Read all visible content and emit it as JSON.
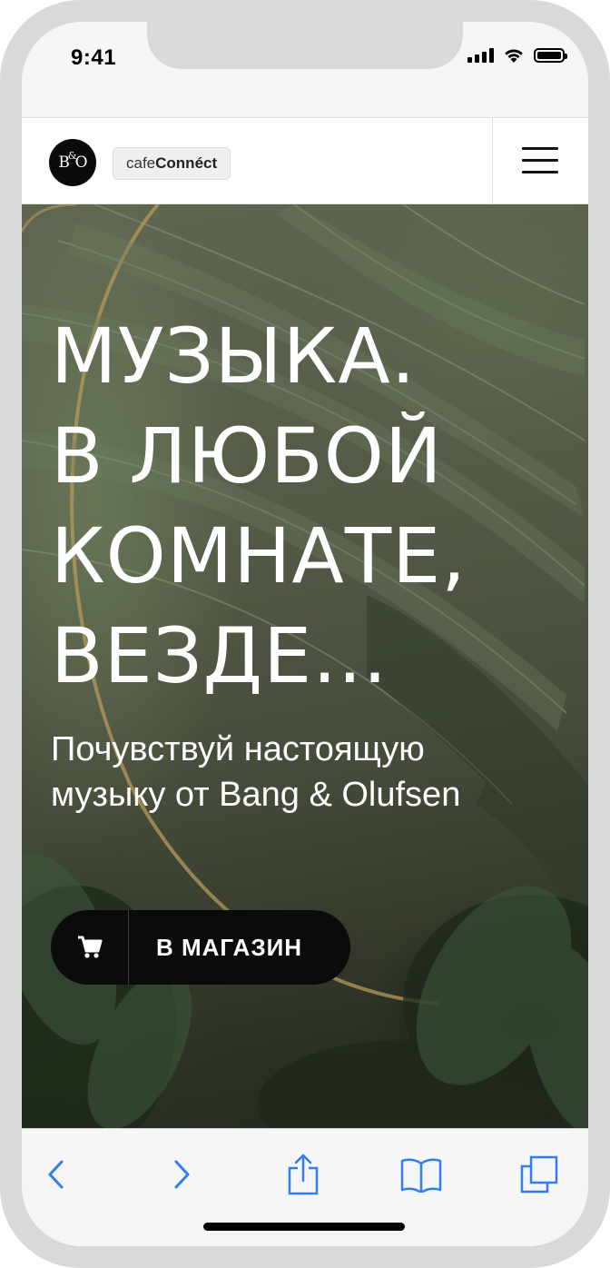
{
  "status_bar": {
    "time": "9:41"
  },
  "header": {
    "logo_text": "B&O",
    "brand_light": "cafe",
    "brand_bold": "Connéct"
  },
  "hero": {
    "title_lines": [
      "МУЗЫКА.",
      "В ЛЮБОЙ",
      "КОМНАТЕ,",
      "ВЕЗДЕ..."
    ],
    "subtitle_lines": [
      "Почувствуй настоящую",
      "музыку от Bang & Olufsen"
    ],
    "button_label": "В МАГАЗИН"
  },
  "browser": {
    "icons": [
      "back-icon",
      "forward-icon",
      "share-icon",
      "bookmarks-icon",
      "tabs-icon"
    ],
    "accent_color": "#2f7ef2"
  },
  "colors": {
    "hero_overlay": "#4e5441",
    "button_bg": "#0b0b0b",
    "header_bg": "#ffffff",
    "device_frame": "#d9d9d9"
  }
}
